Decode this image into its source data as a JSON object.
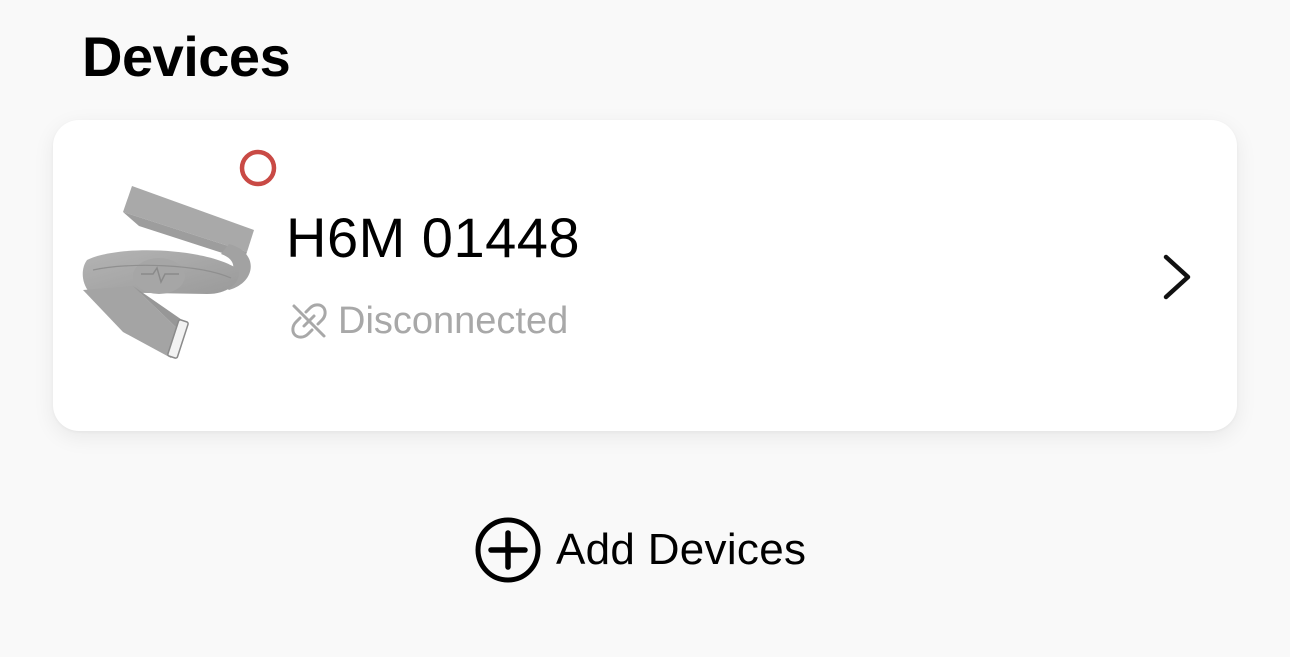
{
  "section": {
    "title": "Devices"
  },
  "device": {
    "name": "H6M 01448",
    "status_text": "Disconnected",
    "status_indicator_color": "#c94a45",
    "status_text_color": "#a8a8a8",
    "image_icon": "heart-rate-chest-strap-image",
    "status_icon": "link-off-icon",
    "nav_icon": "chevron-right-icon"
  },
  "add_devices": {
    "label": "Add Devices",
    "icon": "plus-circle-icon"
  },
  "colors": {
    "background": "#f9f9f9",
    "card": "#ffffff",
    "text": "#000000"
  }
}
